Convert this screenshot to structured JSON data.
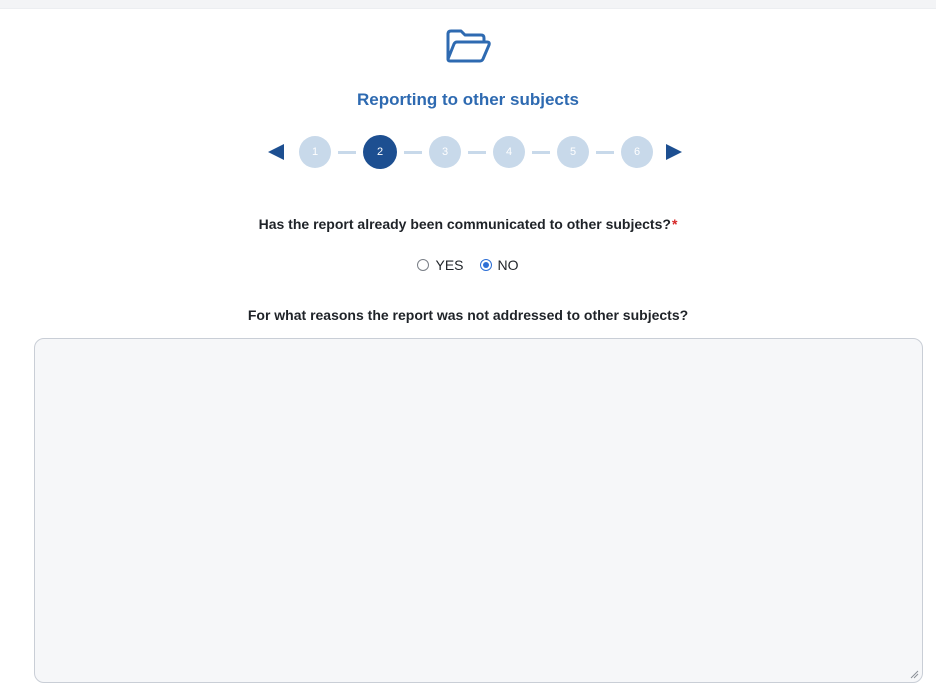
{
  "header": {
    "icon": "folder-open-icon",
    "title": "Reporting to other subjects",
    "accent_color": "#2e6ab1"
  },
  "stepper": {
    "prev_icon": "arrow-left-icon",
    "next_icon": "arrow-right-icon",
    "current_step": 2,
    "steps": [
      {
        "label": "1"
      },
      {
        "label": "2"
      },
      {
        "label": "3"
      },
      {
        "label": "4"
      },
      {
        "label": "5"
      },
      {
        "label": "6"
      }
    ],
    "active_color": "#1d4f91",
    "inactive_color": "#c8d9ea"
  },
  "question1": {
    "text": "Has the report already been communicated to other subjects?",
    "required_mark": "*",
    "options": [
      {
        "label": "YES",
        "checked": false
      },
      {
        "label": "NO",
        "checked": true
      }
    ]
  },
  "question2": {
    "text": "For what reasons the report was not addressed to other subjects?",
    "value": ""
  }
}
